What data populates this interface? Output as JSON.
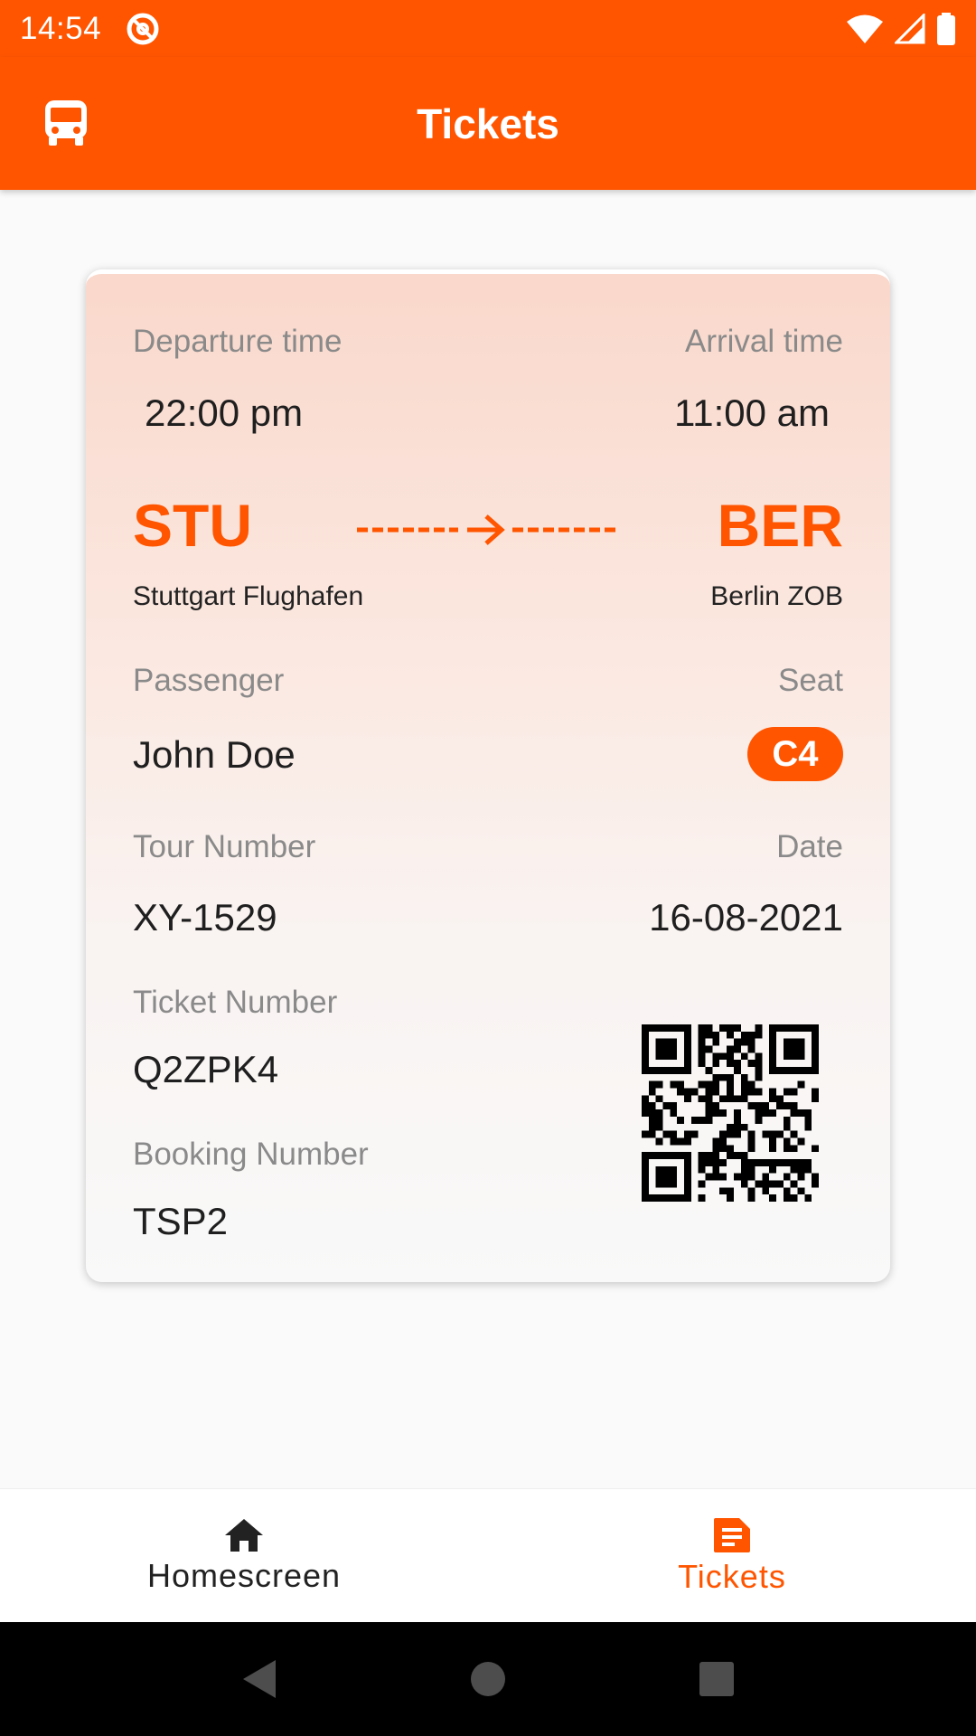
{
  "status_bar": {
    "time": "14:54"
  },
  "app_bar": {
    "title": "Tickets",
    "icon": "bus-icon"
  },
  "ticket": {
    "departure_label": "Departure time",
    "departure_time": "22:00 pm",
    "arrival_label": "Arrival time",
    "arrival_time": "11:00 am",
    "from_code": "STU",
    "from_city": "Stuttgart Flughafen",
    "to_code": "BER",
    "to_city": "Berlin ZOB",
    "passenger_label": "Passenger",
    "passenger_name": "John Doe",
    "seat_label": "Seat",
    "seat": "C4",
    "tour_label": "Tour Number",
    "tour_number": "XY-1529",
    "date_label": "Date",
    "date": "16-08-2021",
    "ticket_label": "Ticket Number",
    "ticket_number": "Q2ZPK4",
    "booking_label": "Booking Number",
    "booking_number": "TSP2"
  },
  "bottom_nav": {
    "items": [
      {
        "label": "Homescreen",
        "icon": "home-icon",
        "active": false
      },
      {
        "label": "Tickets",
        "icon": "ticket-icon",
        "active": true
      }
    ]
  },
  "colors": {
    "accent": "#ff5500",
    "inactive_nav": "#222222"
  }
}
